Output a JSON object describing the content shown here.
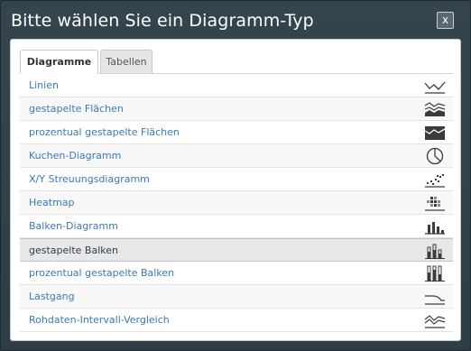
{
  "dialog": {
    "title": "Bitte wählen Sie ein Diagramm-Typ",
    "close_label": "x"
  },
  "tabs": [
    {
      "label": "Diagramme",
      "active": true
    },
    {
      "label": "Tabellen",
      "active": false
    }
  ],
  "chart_types": [
    {
      "label": "Linien",
      "icon": "line-chart-icon"
    },
    {
      "label": "gestapelte Flächen",
      "icon": "stacked-area-icon"
    },
    {
      "label": "prozentual gestapelte Flächen",
      "icon": "percent-stacked-area-icon"
    },
    {
      "label": "Kuchen-Diagramm",
      "icon": "pie-chart-icon"
    },
    {
      "label": "X/Y Streuungsdiagramm",
      "icon": "scatter-chart-icon"
    },
    {
      "label": "Heatmap",
      "icon": "heatmap-icon"
    },
    {
      "label": "Balken-Diagramm",
      "icon": "bar-chart-icon"
    },
    {
      "label": "gestapelte Balken",
      "icon": "stacked-bar-icon",
      "selected": true
    },
    {
      "label": "prozentual gestapelte Balken",
      "icon": "percent-stacked-bar-icon"
    },
    {
      "label": "Lastgang",
      "icon": "load-curve-icon"
    },
    {
      "label": "Rohdaten-Intervall-Vergleich",
      "icon": "interval-compare-icon"
    }
  ],
  "colors": {
    "dialog_bg": "#2e3e47",
    "link": "#3a78b5",
    "selected_row": "#e7e7e7",
    "icon": "#3b3b3b"
  }
}
